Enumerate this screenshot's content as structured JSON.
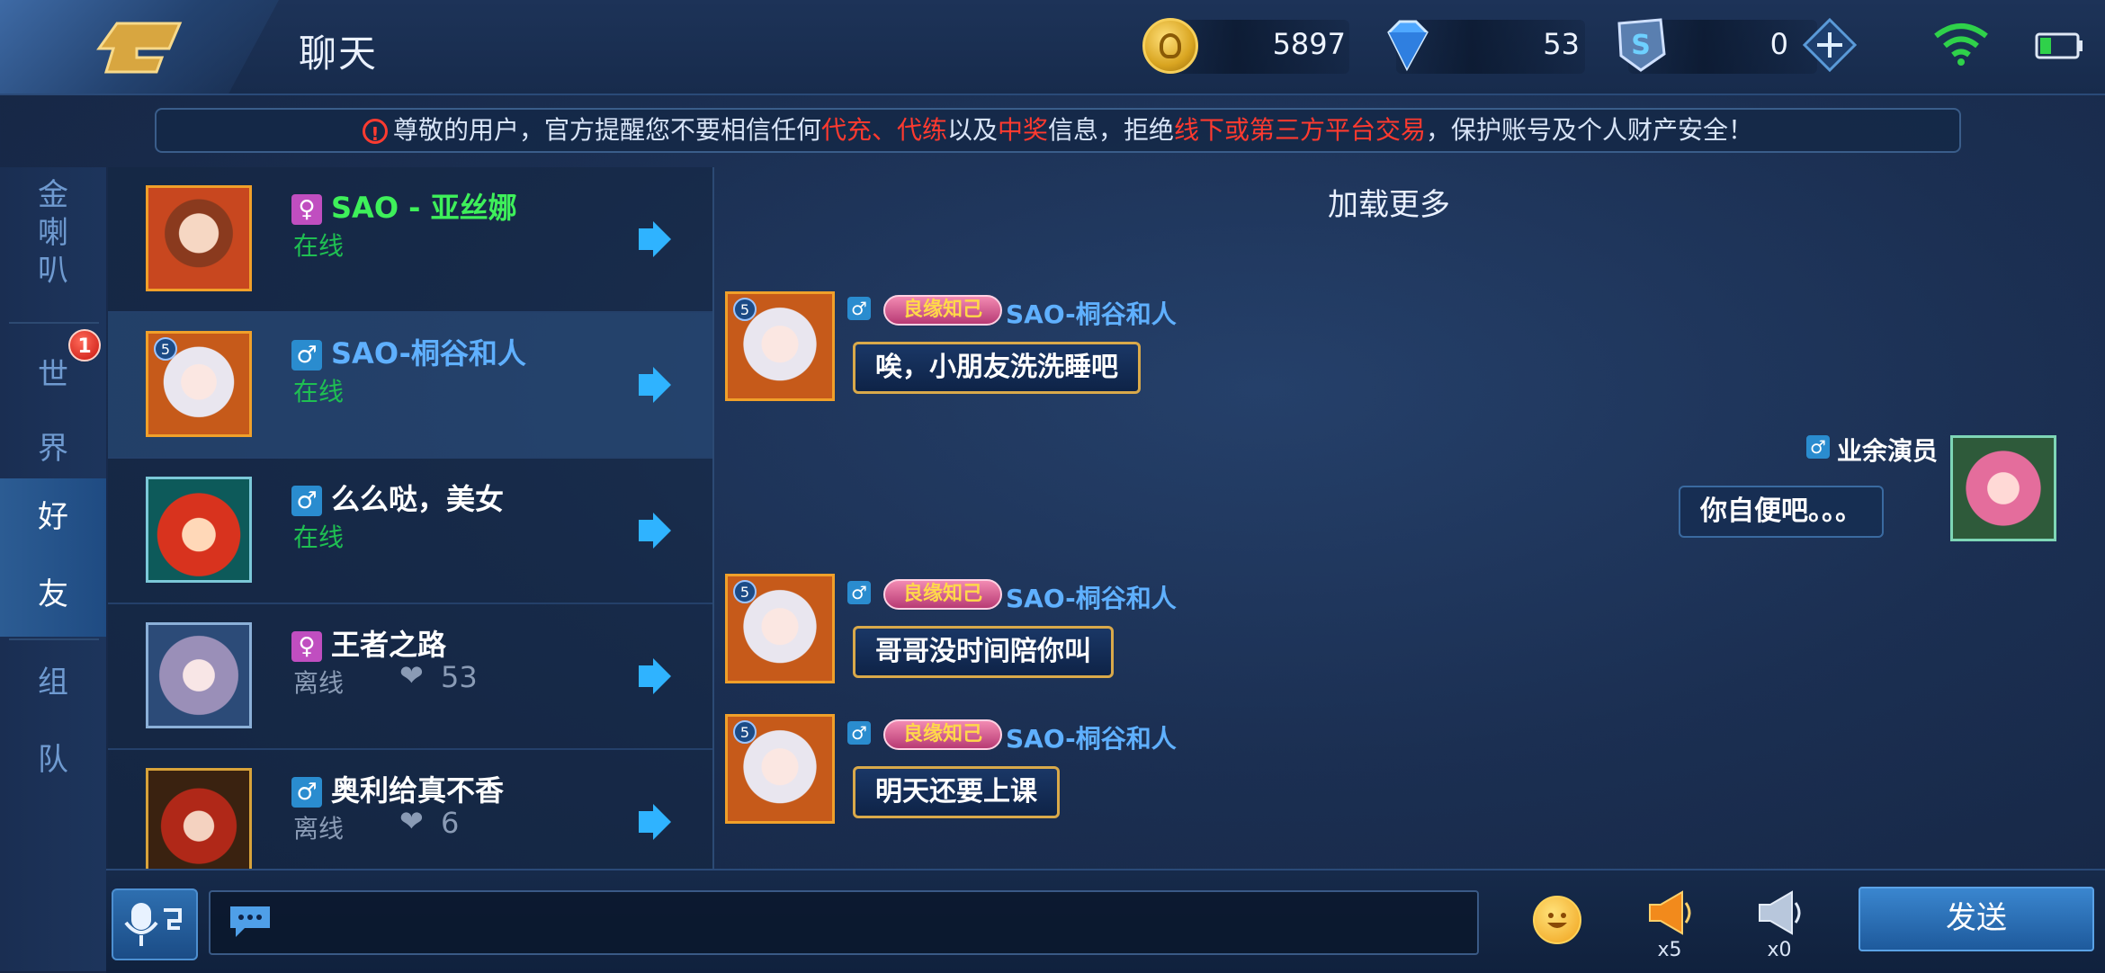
{
  "header": {
    "title": "聊天",
    "gold": "5897",
    "diamonds": "53",
    "tickets": "0"
  },
  "notice": {
    "p1": "尊敬的用户，官方提醒您不要相信任何",
    "r1": "代充、代练",
    "p2": "以及",
    "r2": "中奖",
    "p3": "信息，拒绝",
    "r3": "线下或第三方平台交易",
    "p4": "，保护账号及个人财产安全！"
  },
  "tabs": [
    {
      "chars": [
        "金",
        "喇",
        "叭"
      ]
    },
    {
      "chars": [
        "世",
        "界"
      ],
      "badge": "1"
    },
    {
      "chars": [
        "好",
        "友"
      ]
    },
    {
      "chars": [
        "组",
        "队"
      ]
    }
  ],
  "friends": [
    {
      "name": "SAO - 亚丝娜",
      "gender": "♀",
      "status": "在线"
    },
    {
      "name": "SAO-桐谷和人",
      "gender": "♂",
      "status": "在线",
      "level": "5"
    },
    {
      "name": "么么哒，美女",
      "gender": "♂",
      "status": "在线"
    },
    {
      "name": "王者之路",
      "gender": "♀",
      "status": "离线",
      "intimacy": "53"
    },
    {
      "name": "奥利给真不香",
      "gender": "♂",
      "status": "离线",
      "intimacy": "6"
    }
  ],
  "chat": {
    "load_more": "加载更多",
    "tag": "良缘知己",
    "messages": [
      {
        "sender": "SAO-桐谷和人",
        "gender": "♂",
        "text": "唉，小朋友洗洗睡吧",
        "level": "5"
      },
      {
        "sender": "业余演员",
        "gender": "♂",
        "text": "你自便吧。。。"
      },
      {
        "sender": "SAO-桐谷和人",
        "gender": "♂",
        "text": "哥哥没时间陪你叫",
        "level": "5"
      },
      {
        "sender": "SAO-桐谷和人",
        "gender": "♂",
        "text": "明天还要上课",
        "level": "5"
      }
    ]
  },
  "bottom": {
    "horn_large_count": "x5",
    "horn_small_count": "x0",
    "send_label": "发送",
    "input_value": ""
  },
  "colors": {
    "online": "#1fbf52",
    "warning_red": "#ff3a2f",
    "sender_blue": "#5fb0ff",
    "friend_name_green": "#3ef05a"
  }
}
